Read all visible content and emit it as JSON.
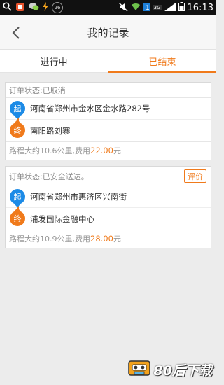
{
  "statusbar": {
    "circle_num": "26",
    "network": "3G",
    "time": "16:13"
  },
  "header": {
    "title": "我的记录"
  },
  "tabs": [
    {
      "label": "进行中",
      "active": false
    },
    {
      "label": "已结束",
      "active": true
    }
  ],
  "orders": [
    {
      "status": "订单状态:已取消",
      "start_badge": "起",
      "start": "河南省郑州市金水区金水路282号",
      "end_badge": "终",
      "end": "南阳路刘寨",
      "fare_prefix": "路程大约10.6公里,费用",
      "fare_amount": "22.00",
      "fare_unit": "元"
    },
    {
      "status": "订单状态:已安全送达。",
      "rate_label": "评价",
      "start_badge": "起",
      "start": "河南省郑州市惠济区兴南街",
      "end_badge": "终",
      "end": "浦发国际金融中心",
      "fare_prefix": "路程大约10.9公里,费用",
      "fare_amount": "28.00",
      "fare_unit": "元"
    }
  ],
  "watermark": {
    "text": "80后下载"
  },
  "colors": {
    "accent": "#f07a1b",
    "start_blue": "#1d8be6",
    "background": "#ececec"
  }
}
